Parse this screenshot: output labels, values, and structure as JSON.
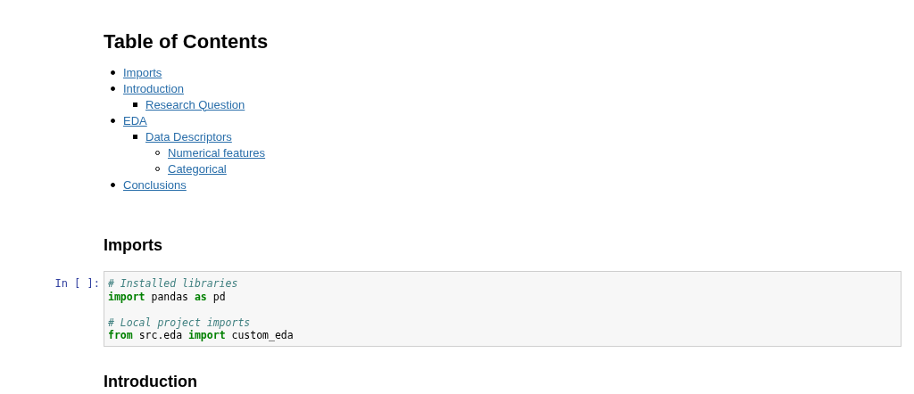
{
  "toc": {
    "title": "Table of Contents",
    "items": [
      {
        "label": "Imports"
      },
      {
        "label": "Introduction",
        "children": [
          {
            "label": "Research Question"
          }
        ]
      },
      {
        "label": "EDA",
        "children": [
          {
            "label": "Data Descriptors",
            "children": [
              {
                "label": "Numerical features"
              },
              {
                "label": "Categorical"
              }
            ]
          }
        ]
      },
      {
        "label": "Conclusions"
      }
    ]
  },
  "sections": [
    {
      "heading": "Imports",
      "cell": {
        "prompt": "In [ ]:",
        "blocks": [
          [
            [
              {
                "kind": "comment",
                "text": "# Installed libraries"
              }
            ],
            [
              {
                "kind": "keyword",
                "text": "import"
              },
              {
                "kind": "plain",
                "text": " pandas "
              },
              {
                "kind": "keyword",
                "text": "as"
              },
              {
                "kind": "plain",
                "text": " pd"
              }
            ]
          ],
          [
            [
              {
                "kind": "comment",
                "text": "# Local project imports"
              }
            ],
            [
              {
                "kind": "keyword",
                "text": "from"
              },
              {
                "kind": "plain",
                "text": " src.eda "
              },
              {
                "kind": "keyword",
                "text": "import"
              },
              {
                "kind": "plain",
                "text": " custom_eda"
              }
            ]
          ]
        ]
      }
    },
    {
      "heading": "Introduction"
    }
  ]
}
